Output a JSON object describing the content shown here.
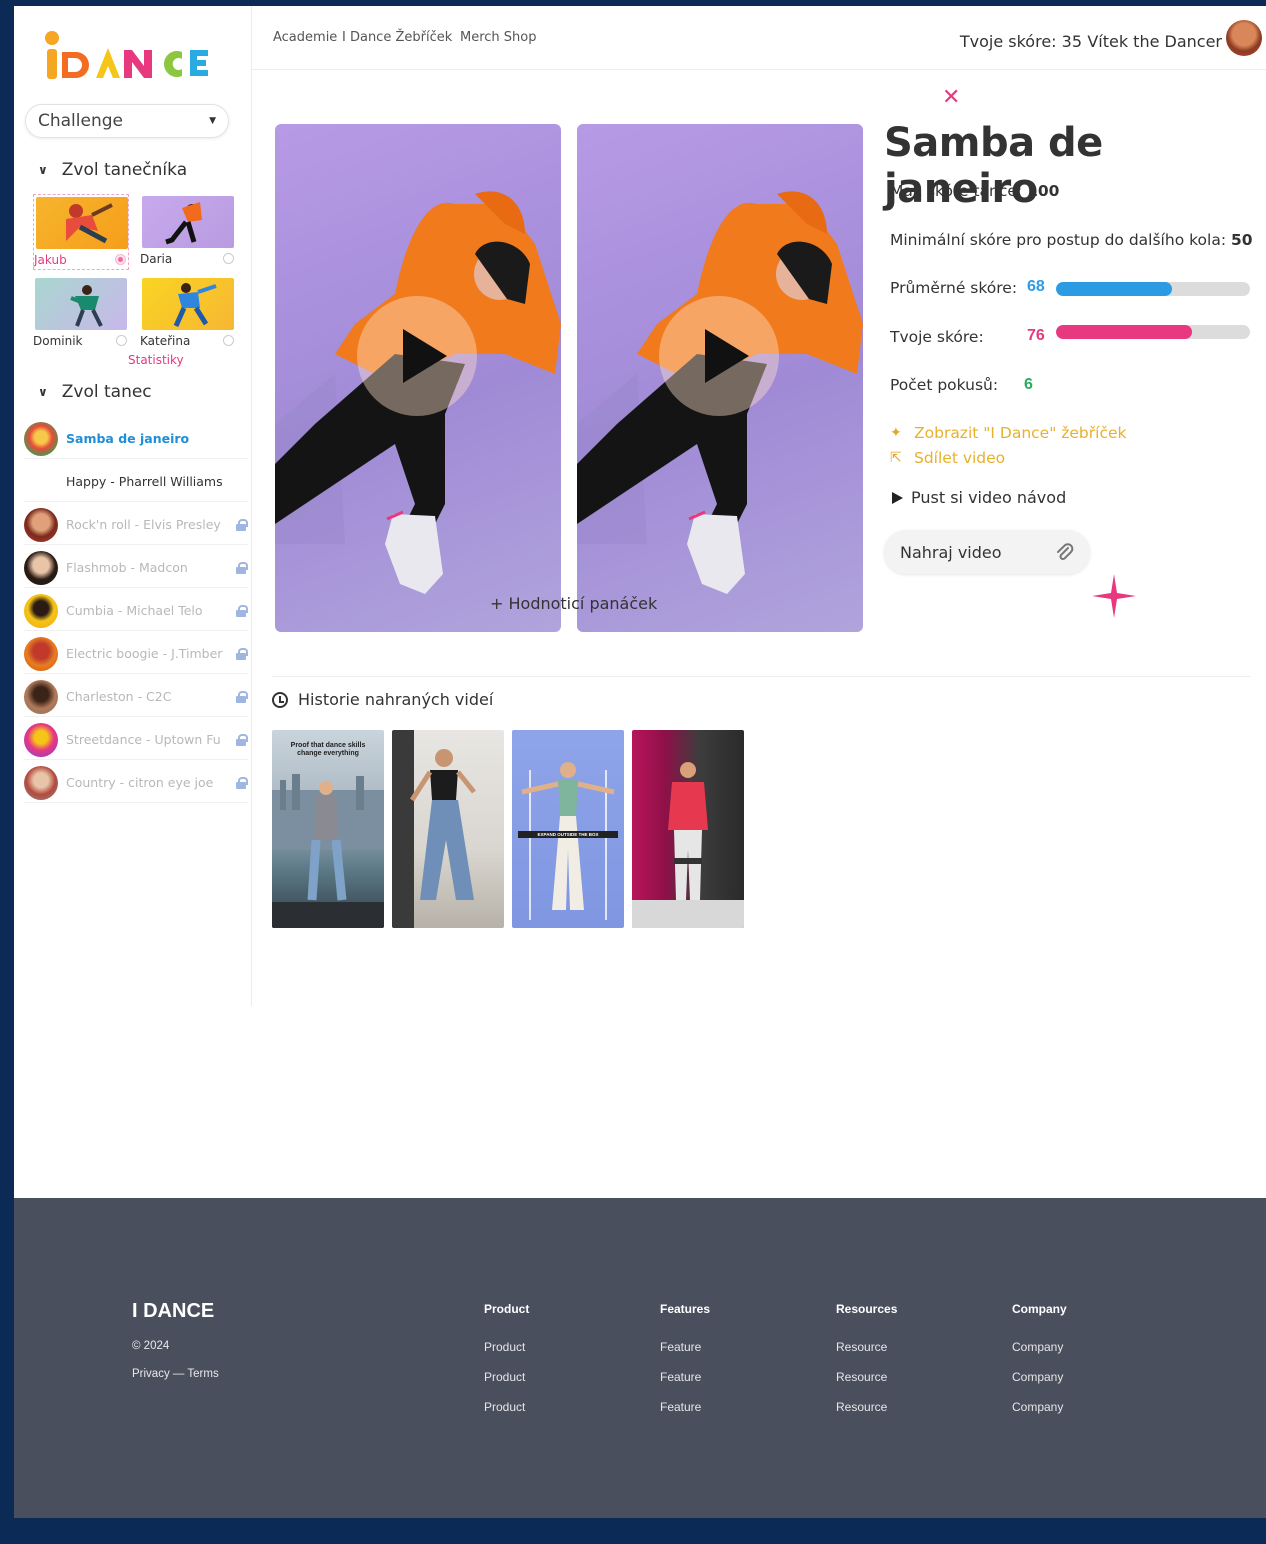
{
  "brand": {
    "logo_text": "iDANCE"
  },
  "challenge_select": {
    "value": "Challenge"
  },
  "dancer_section": {
    "title": "Zvol tanečníka",
    "dancers": [
      {
        "name": "Jakub",
        "selected": true
      },
      {
        "name": "Daria",
        "selected": false
      },
      {
        "name": "Dominik",
        "selected": false
      },
      {
        "name": "Kateřina",
        "selected": false
      }
    ],
    "stats_link": "Statistiky"
  },
  "dance_section": {
    "title": "Zvol tanec",
    "items": [
      {
        "label": "Samba de janeiro",
        "state": "active"
      },
      {
        "label": "Happy - Pharrell Williams",
        "state": "available"
      },
      {
        "label": "Rock'n roll - Elvis Presley",
        "state": "locked"
      },
      {
        "label": "Flashmob - Madcon",
        "state": "locked"
      },
      {
        "label": "Cumbia - Michael Telo",
        "state": "locked"
      },
      {
        "label": "Electric boogie - J.Timber",
        "state": "locked"
      },
      {
        "label": "Charleston - C2C",
        "state": "locked"
      },
      {
        "label": "Streetdance - Uptown Fu",
        "state": "locked"
      },
      {
        "label": "Country - citron eye joe",
        "state": "locked"
      }
    ]
  },
  "nav": {
    "links": [
      "Academie",
      "I Dance Žebříček",
      "Merch Shop"
    ],
    "score_label": "Tvoje skóre: 35",
    "user_name": "Vítek the Dancer"
  },
  "player": {
    "overlay_label": "+ Hodnoticí panáček"
  },
  "dance_detail": {
    "title": "Samba de janeiro",
    "max_score_label": "Max skóre tance:",
    "max_score": "100",
    "min_score_label": "Minimální skóre pro postup do dalšího kola:",
    "min_score": "50",
    "avg_score_label": "Průměrné skóre:",
    "avg_score": "68",
    "avg_score_fraction": 0.6,
    "your_score_label": "Tvoje skóre:",
    "your_score": "76",
    "your_score_fraction": 0.7,
    "attempts_label": "Počet pokusů:",
    "attempts": "6",
    "leaderboard_link": "Zobrazit \"I Dance\" žebříček",
    "share_link": "Sdílet video",
    "tutorial_link": "Pust si video návod",
    "upload_button": "Nahraj video"
  },
  "history": {
    "title": "Historie nahraných videí",
    "thumb_caption_1": "Proof that dance skills change everything",
    "thumb_caption_3": "EXPAND OUTSIDE THE BOX"
  },
  "footer": {
    "brand": "I DANCE",
    "copyright": "© 2024",
    "legal": "Privacy — Terms",
    "columns": [
      {
        "title": "Product",
        "items": [
          "Product",
          "Product",
          "Product"
        ]
      },
      {
        "title": "Features",
        "items": [
          "Feature",
          "Feature",
          "Feature"
        ]
      },
      {
        "title": "Resources",
        "items": [
          "Resource",
          "Resource",
          "Resource"
        ]
      },
      {
        "title": "Company",
        "items": [
          "Company",
          "Company",
          "Company"
        ]
      }
    ]
  },
  "colors": {
    "accent_pink": "#e8387f",
    "accent_blue": "#2d9be3",
    "accent_green": "#2eaa5f",
    "accent_gold": "#e8b12c",
    "page_frame": "#0b2a55",
    "footer_bg": "#4a4f5d"
  }
}
